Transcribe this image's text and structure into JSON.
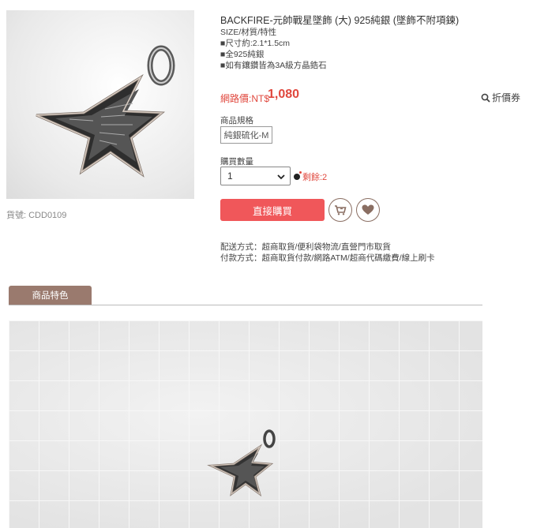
{
  "product": {
    "title": "BACKFIRE-元帥戰星墜飾 (大) 925純銀 (墜飾不附項鍊)",
    "sku": "貨號: CDD0109",
    "desc": [
      "SIZE/材質/特性",
      "■尺寸約:2.1*1.5cm",
      "■全925純銀",
      "■如有鑲鑽皆為3A級方晶鋯石"
    ]
  },
  "price": {
    "label": "網路價:NT$",
    "value": "1,080",
    "coupon_label": "折價券"
  },
  "spec": {
    "label": "商品規格",
    "option": "純銀硫化-M"
  },
  "quantity": {
    "label": "購買數量",
    "selected": "1",
    "stock_text": "剩餘:2"
  },
  "actions": {
    "buy_label": "直接購買"
  },
  "info": {
    "delivery": "配送方式：超商取貨/便利袋物流/直營門市取貨",
    "payment": "付款方式：超商取貨付款/網路ATM/超商代碼繳費/線上刷卡"
  },
  "tabs": {
    "features_label": "商品特色"
  },
  "icons": {
    "search": "search-icon",
    "cart": "cart-icon",
    "heart": "heart-icon",
    "bomb": "bomb-icon",
    "caret": "chevron-down-icon"
  },
  "colors": {
    "accent_red": "#e0483e",
    "buy_button": "#f0575a",
    "tab_brown": "#9a7a6e"
  }
}
